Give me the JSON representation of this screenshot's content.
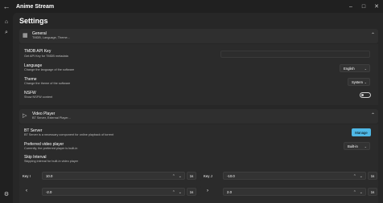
{
  "app": {
    "title": "Anime Stream"
  },
  "icons": {
    "back": "←",
    "minimize": "–",
    "maximize": "□",
    "close": "✕",
    "home": "⌂",
    "search": "⌕",
    "settings": "⚙",
    "general": "▦",
    "video": "▷",
    "chevron_up": "⌃",
    "chevron_down": "⌄",
    "spin_up": "⌃",
    "spin_down": "⌄",
    "left_arrow": "‹",
    "right_arrow": "›"
  },
  "page": {
    "title": "Settings"
  },
  "general": {
    "title": "General",
    "subtitle": "TMDB, Language, Theme...",
    "tmdb": {
      "title": "TMDB API Key",
      "desc": "Get API Key for TMDB metadata",
      "value": ""
    },
    "language": {
      "title": "Language",
      "desc": "Change the language of the software",
      "value": "English"
    },
    "theme": {
      "title": "Theme",
      "desc": "Change the theme of the software",
      "value": "System"
    },
    "nsfw": {
      "title": "NSFW",
      "desc": "Show NSFW content",
      "enabled": false
    }
  },
  "video": {
    "title": "Video Player",
    "subtitle": "BT Server, External Player...",
    "bt_server": {
      "title": "BT Server",
      "desc": "BT Server is a necessary component for online playback of torrent",
      "button": "Manage"
    },
    "player": {
      "title": "Preferred video player",
      "desc": "Currently, the preferred player is built-in",
      "value": "Built-in"
    },
    "skip": {
      "title": "Skip Interval",
      "desc": "Skipping interval for built-in video player"
    },
    "keys": [
      {
        "label": "Key I",
        "value": "10.0",
        "unit": "1s"
      },
      {
        "label": "Key J",
        "value": "-10.0",
        "unit": "1s"
      },
      {
        "value": "-2.0",
        "unit": "1s"
      },
      {
        "value": "2.0",
        "unit": "1s"
      }
    ]
  },
  "colors": {
    "accent": "#4fb8e6",
    "background": "#202020",
    "card": "#2b2b2b"
  }
}
